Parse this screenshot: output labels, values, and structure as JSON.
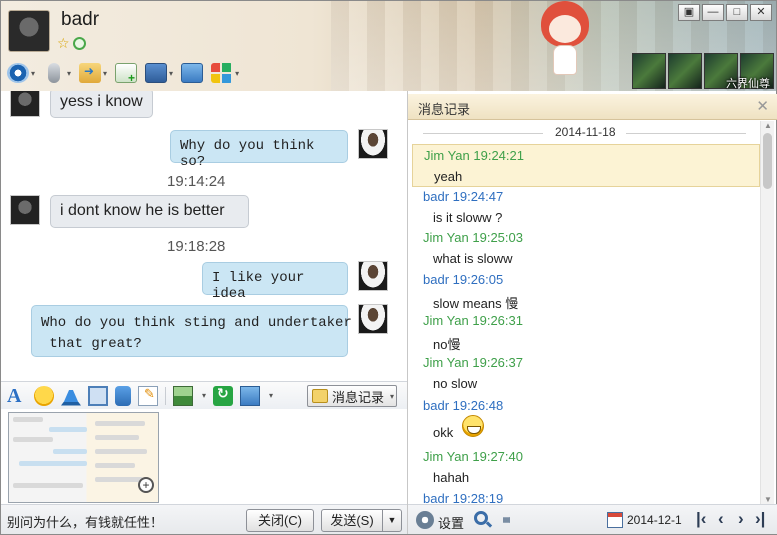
{
  "header": {
    "contact_name": "badr",
    "game_caption": "六界仙尊",
    "toolbar_icons": [
      "camera-icon",
      "microphone-icon",
      "send-file-icon",
      "add-chat-icon",
      "remote-screen-icon",
      "share-screen-icon",
      "apps-icon"
    ],
    "window_controls": [
      "skin-icon",
      "minimize-icon",
      "maximize-icon",
      "close-icon"
    ],
    "window_control_glyphs": [
      "▣",
      "—",
      "□",
      "✕"
    ]
  },
  "chat": {
    "messages": [
      {
        "from": "badr",
        "direction": "in",
        "text": "yess i know"
      },
      {
        "from": "Jim Yan",
        "direction": "out",
        "text": "Why do you think so?"
      },
      {
        "type": "time",
        "text": "19:14:24"
      },
      {
        "from": "badr",
        "direction": "in",
        "text": "i dont know he is better"
      },
      {
        "type": "time",
        "text": "19:18:28"
      },
      {
        "from": "Jim Yan",
        "direction": "out",
        "text": "I like your idea"
      },
      {
        "from": "Jim Yan",
        "direction": "out",
        "text_line1": "Who do you think sting and undertaker",
        "text_line2": " that great?"
      }
    ]
  },
  "input_toolbar": {
    "font_glyph": "A",
    "history_button_label": "消息记录"
  },
  "footer": {
    "status_text": "别问为什么，有钱就任性！",
    "close_label": "关闭(C)",
    "send_label": "发送(S)"
  },
  "history": {
    "title": "消息记录",
    "close_glyph": "✕",
    "date": "2014-11-18",
    "entries": [
      {
        "sender": "Jim Yan 19:24:21",
        "who": "jim",
        "text": "yeah",
        "highlighted": true
      },
      {
        "sender": "badr 19:24:47",
        "who": "badr",
        "text": "is it sloww ?"
      },
      {
        "sender": "Jim Yan 19:25:03",
        "who": "jim",
        "text": "what is sloww"
      },
      {
        "sender": "badr 19:26:05",
        "who": "badr",
        "text": "slow means 慢"
      },
      {
        "sender": "Jim Yan 19:26:31",
        "who": "jim",
        "text": "no慢"
      },
      {
        "sender": "Jim Yan 19:26:37",
        "who": "jim",
        "text": "no slow"
      },
      {
        "sender": "badr 19:26:48",
        "who": "badr",
        "text": "okk",
        "emoji": "grin-icon"
      },
      {
        "sender": "Jim Yan 19:27:40",
        "who": "jim",
        "text": "hahah"
      },
      {
        "sender": "badr 19:28:19",
        "who": "badr",
        "text": ""
      }
    ],
    "footer": {
      "settings_label": "设置",
      "calendar_date": "2014-12-1",
      "nav_first": "|‹",
      "nav_prev": "‹",
      "nav_next": "›",
      "nav_last": "›|"
    }
  },
  "colors": {
    "jim_sender": "#3fa04a",
    "badr_sender": "#2f6fc0",
    "out_bubble": "#cbe6f4",
    "in_bubble": "#e8ebef",
    "highlight_row": "#fcf3d4"
  }
}
